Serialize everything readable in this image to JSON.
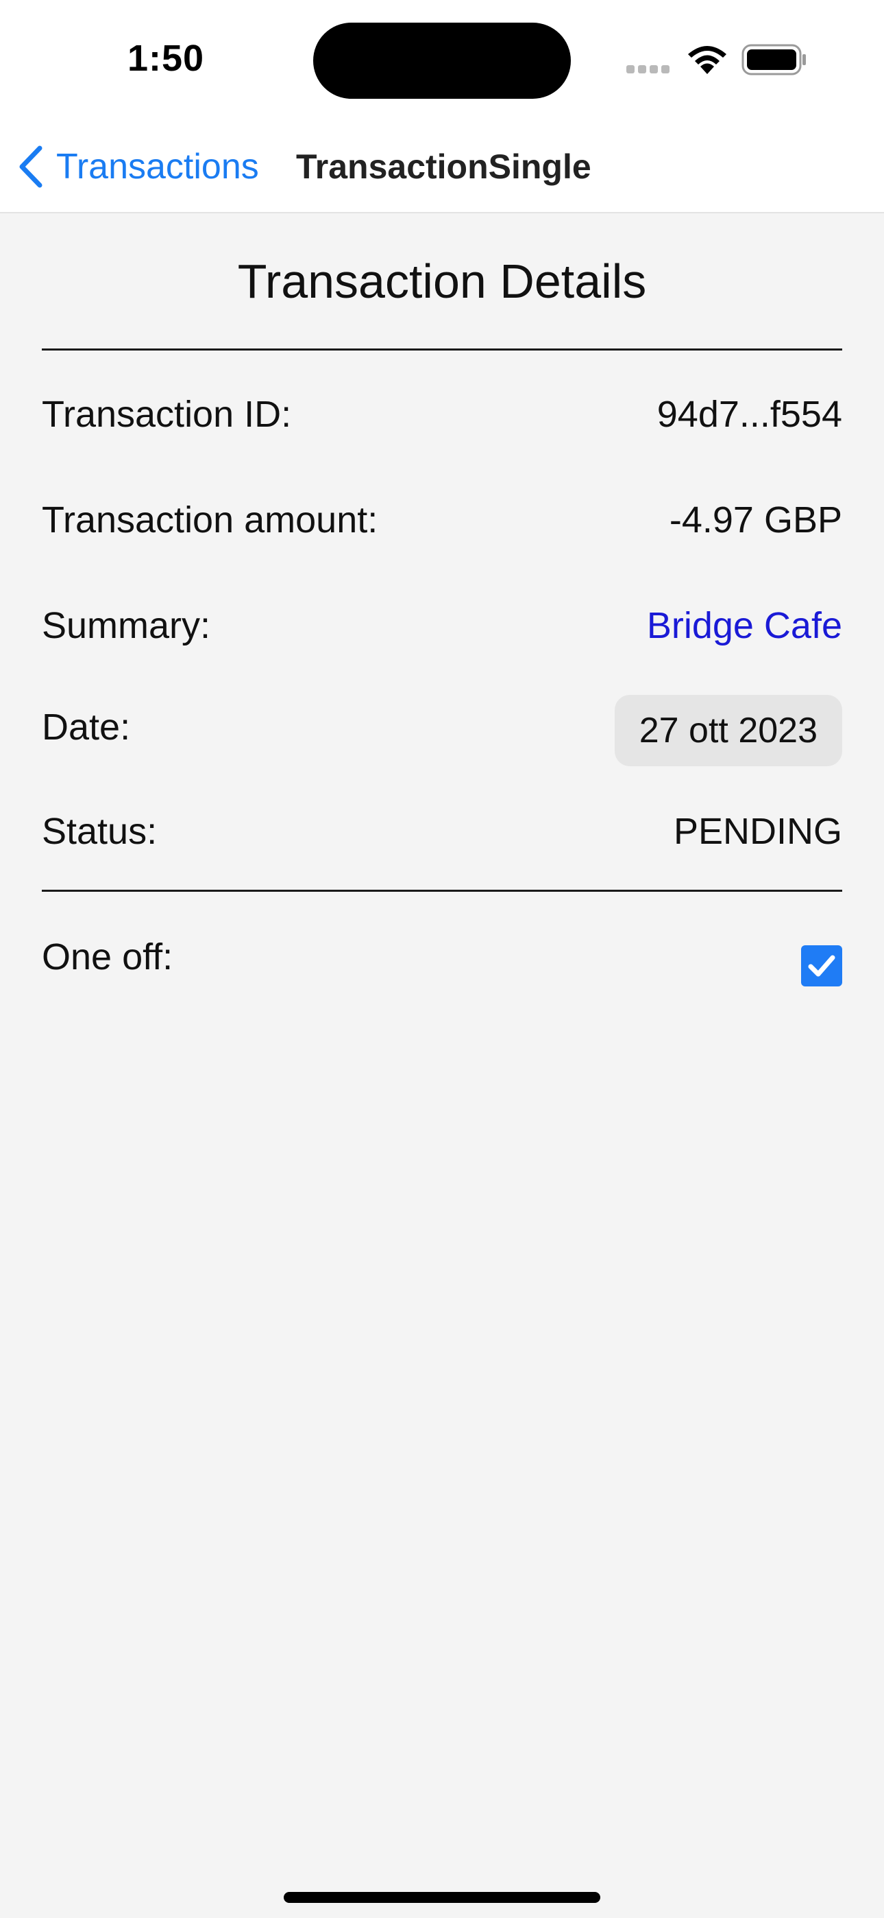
{
  "status_bar": {
    "time": "1:50"
  },
  "nav": {
    "back_label": "Transactions",
    "title": "TransactionSingle"
  },
  "details": {
    "title": "Transaction Details",
    "transaction_id_label": "Transaction ID:",
    "transaction_id_value": "94d7...f554",
    "amount_label": "Transaction amount:",
    "amount_value": "-4.97 GBP",
    "summary_label": "Summary:",
    "summary_value": "Bridge Cafe",
    "date_label": "Date:",
    "date_value": "27 ott 2023",
    "status_label": "Status:",
    "status_value": "PENDING",
    "one_off_label": "One off:",
    "one_off_checked": true
  },
  "colors": {
    "accent": "#1a7cf2",
    "link": "#1a1ad6",
    "checkbox": "#1f7cf5",
    "background": "#f4f4f4"
  }
}
